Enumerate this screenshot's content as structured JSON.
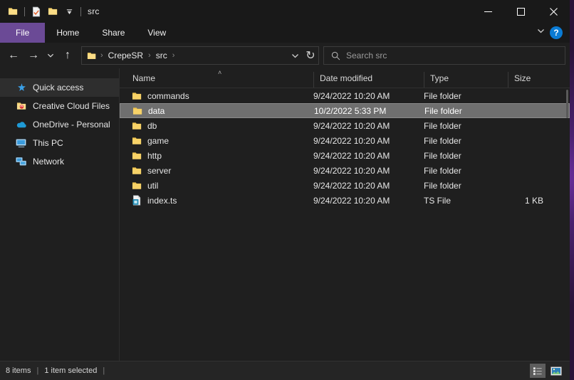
{
  "window": {
    "title": "src",
    "quick_access": [
      {
        "name": "folder-icon",
        "label": "Folder"
      },
      {
        "name": "properties-icon",
        "label": "Properties"
      },
      {
        "name": "new-folder-icon",
        "label": "New folder"
      },
      {
        "name": "customize-quick-access-chevron-icon",
        "label": "Customize Quick Access Toolbar"
      }
    ],
    "controls": {
      "minimize": "─",
      "maximize": "□",
      "close": "✕"
    }
  },
  "ribbon": {
    "tabs": [
      {
        "label": "File",
        "active": true
      },
      {
        "label": "Home",
        "active": false
      },
      {
        "label": "Share",
        "active": false
      },
      {
        "label": "View",
        "active": false
      }
    ],
    "expand_icon": "chevron-down-icon",
    "help_label": "?"
  },
  "navbar": {
    "back_icon": "←",
    "forward_icon": "→",
    "recent_icon": "ˇ",
    "up_icon": "↑",
    "breadcrumb": [
      "CrepeSR",
      "src"
    ],
    "breadcrumb_separator": "›",
    "dropdown_icon": "ˇ",
    "refresh_icon": "↻"
  },
  "search": {
    "icon": "search-icon",
    "placeholder": "Search src",
    "value": ""
  },
  "sidebar": {
    "items": [
      {
        "label": "Quick access",
        "icon": "star-icon",
        "selected": true
      },
      {
        "label": "Creative Cloud Files",
        "icon": "creative-cloud-folder-icon",
        "selected": false
      },
      {
        "label": "OneDrive - Personal",
        "icon": "onedrive-cloud-icon",
        "selected": false
      },
      {
        "label": "This PC",
        "icon": "this-pc-monitor-icon",
        "selected": false
      },
      {
        "label": "Network",
        "icon": "network-icon",
        "selected": false
      }
    ]
  },
  "filelist": {
    "columns": [
      {
        "label": "Name",
        "sorted": "asc"
      },
      {
        "label": "Date modified",
        "sorted": ""
      },
      {
        "label": "Type",
        "sorted": ""
      },
      {
        "label": "Size",
        "sorted": ""
      }
    ],
    "sort_caret": "˄",
    "rows": [
      {
        "name": "commands",
        "date": "9/24/2022 10:20 AM",
        "type": "File folder",
        "size": "",
        "icon": "folder-icon",
        "selected": false
      },
      {
        "name": "data",
        "date": "10/2/2022 5:33 PM",
        "type": "File folder",
        "size": "",
        "icon": "folder-icon",
        "selected": true
      },
      {
        "name": "db",
        "date": "9/24/2022 10:20 AM",
        "type": "File folder",
        "size": "",
        "icon": "folder-icon",
        "selected": false
      },
      {
        "name": "game",
        "date": "9/24/2022 10:20 AM",
        "type": "File folder",
        "size": "",
        "icon": "folder-icon",
        "selected": false
      },
      {
        "name": "http",
        "date": "9/24/2022 10:20 AM",
        "type": "File folder",
        "size": "",
        "icon": "folder-icon",
        "selected": false
      },
      {
        "name": "server",
        "date": "9/24/2022 10:20 AM",
        "type": "File folder",
        "size": "",
        "icon": "folder-icon",
        "selected": false
      },
      {
        "name": "util",
        "date": "9/24/2022 10:20 AM",
        "type": "File folder",
        "size": "",
        "icon": "folder-icon",
        "selected": false
      },
      {
        "name": "index.ts",
        "date": "9/24/2022 10:20 AM",
        "type": "TS File",
        "size": "1 KB",
        "icon": "ts-file-icon",
        "selected": false
      }
    ]
  },
  "statusbar": {
    "item_count": "8 items",
    "separator1": "|",
    "selection": "1 item selected",
    "separator2": "|",
    "views": [
      {
        "name": "details-view-button",
        "active": true
      },
      {
        "name": "large-icons-view-button",
        "active": false
      }
    ]
  },
  "colors": {
    "accent": "#6b4a96",
    "window_bg": "#1f1f1f",
    "selection": "#6f6f6f",
    "folder_yellow": "#f5c council",
    "help_blue": "#0a7bd4"
  }
}
